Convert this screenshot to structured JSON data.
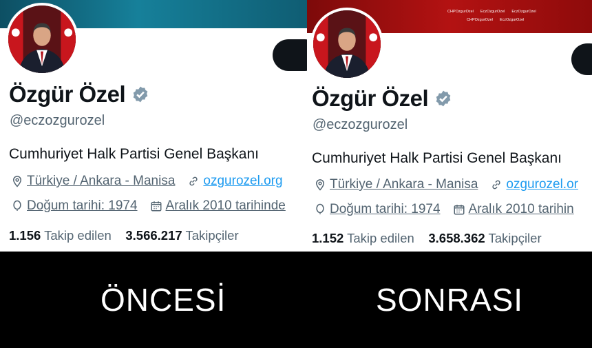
{
  "before": {
    "caption": "ÖNCESİ",
    "name": "Özgür Özel",
    "handle": "@eczozgurozel",
    "bio": "Cumhuriyet Halk Partisi Genel Başkanı",
    "location": "Türkiye / Ankara - Manisa",
    "website": "ozgurozel.org",
    "birth": "Doğum tarihi: 1974",
    "joined": "Aralık 2010 tarihinde",
    "following_count": "1.156",
    "following_label": "Takip edilen",
    "followers_count": "3.566.217",
    "followers_label": "Takipçiler"
  },
  "after": {
    "caption": "SONRASI",
    "name": "Özgür Özel",
    "handle": "@eczozgurozel",
    "bio": "Cumhuriyet Halk Partisi Genel Başkanı",
    "location": "Türkiye / Ankara - Manisa",
    "website": "ozgurozel.or",
    "birth": "Doğum tarihi: 1974",
    "joined": "Aralık 2010 tarihin",
    "following_count": "1.152",
    "following_label": "Takip edilen",
    "followers_count": "3.658.362",
    "followers_label": "Takipçiler",
    "banner_socials": [
      "CHPOzgurOzel",
      "EczOzgurOzel",
      "EczOzgurOzel",
      "CHPOzgurOzel",
      "EczOzgurOzel"
    ]
  },
  "colors": {
    "verified": "#829aab",
    "link": "#1d9bf0",
    "secondary_text": "#536471"
  }
}
